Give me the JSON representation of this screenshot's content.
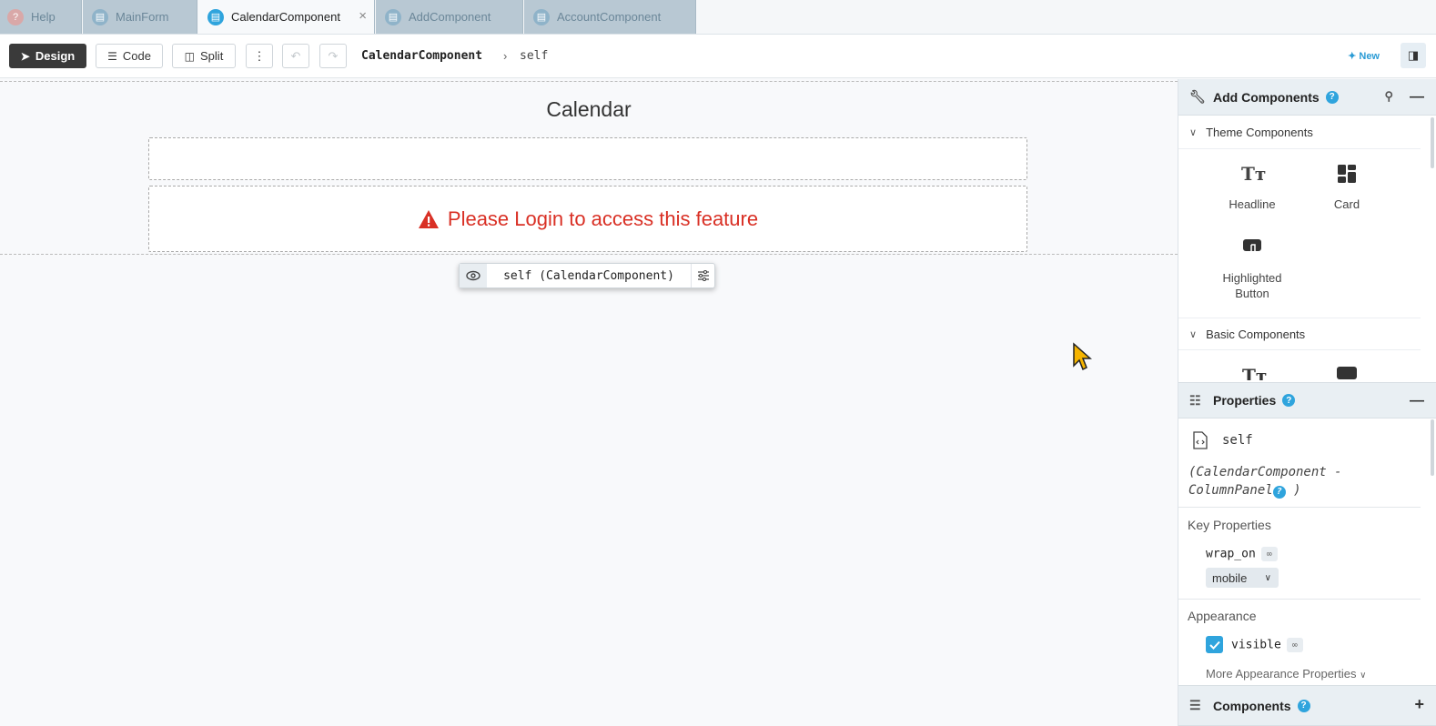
{
  "tabs": [
    {
      "label": "Help",
      "icon": "help-icon"
    },
    {
      "label": "MainForm",
      "icon": "document-icon"
    },
    {
      "label": "CalendarComponent",
      "icon": "document-icon",
      "active": true,
      "close": "×"
    },
    {
      "label": "AddComponent",
      "icon": "document-icon"
    },
    {
      "label": "AccountComponent",
      "icon": "document-icon"
    }
  ],
  "toolbar": {
    "design_label": "Design",
    "code_label": "Code",
    "split_label": "Split",
    "more_label": "⋮",
    "breadcrumb_main": "CalendarComponent",
    "breadcrumb_sep": "›",
    "breadcrumb_self": "self",
    "new_label": "New"
  },
  "canvas": {
    "title": "Calendar",
    "login_message": "Please Login to access this feature",
    "selection_label": "self (CalendarComponent)"
  },
  "add_components": {
    "title": "Add Components",
    "help": "?",
    "theme_section": "Theme Components",
    "theme_items": [
      "Headline",
      "Card",
      "Highlighted Button"
    ],
    "basic_section": "Basic Components"
  },
  "properties": {
    "title": "Properties",
    "help": "?",
    "component_name": "self",
    "component_type_line1": "(CalendarComponent -",
    "component_type_line2": "ColumnPanel",
    "component_type_close": ")",
    "key_properties_label": "Key Properties",
    "wrap_on_label": "wrap_on",
    "wrap_on_value": "mobile",
    "appearance_label": "Appearance",
    "visible_label": "visible",
    "visible_checked": true,
    "more_appearance": "More Appearance Properties"
  },
  "components_panel": {
    "title": "Components",
    "help": "?",
    "add": "+"
  },
  "colors": {
    "accent": "#2fa4dd",
    "error": "#d93025",
    "dark_button": "#3a3a3a",
    "cursor": "#f5b400"
  }
}
